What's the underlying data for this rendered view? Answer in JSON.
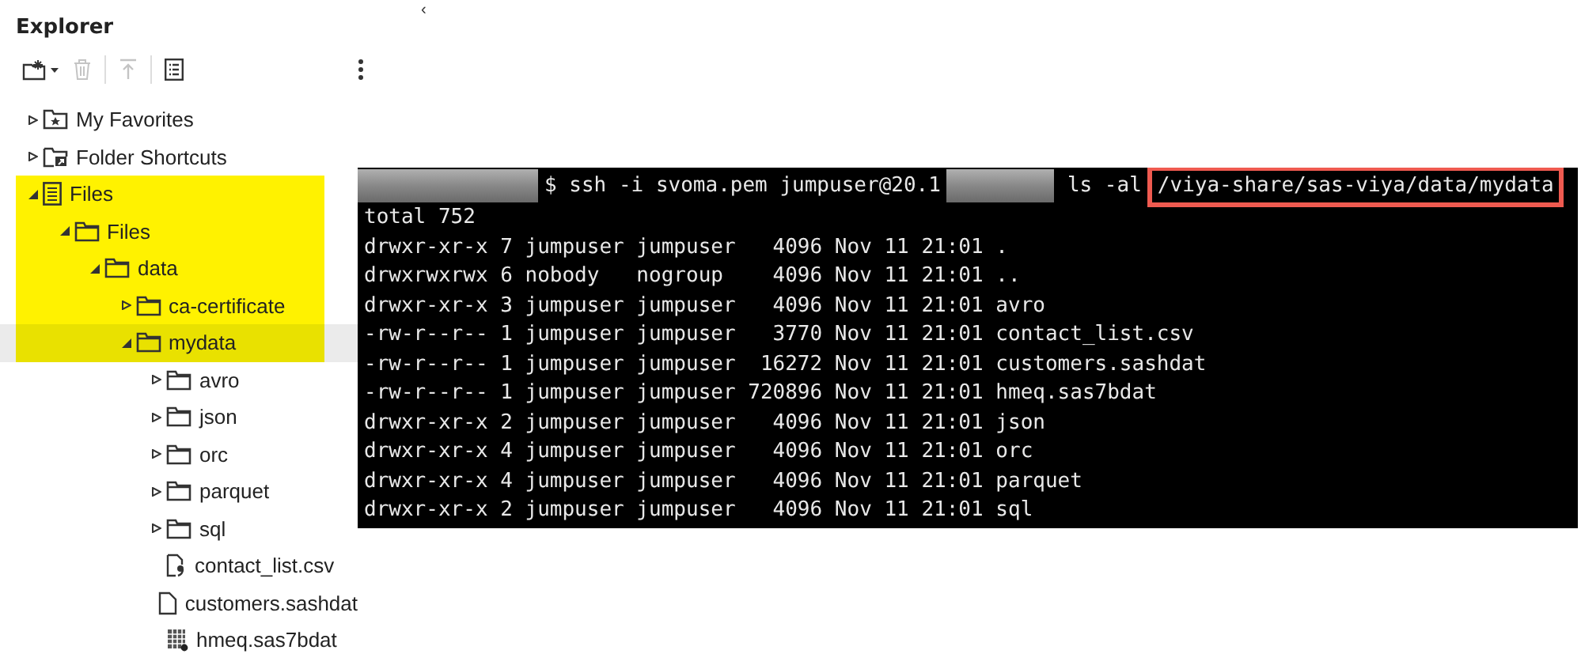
{
  "explorer": {
    "title": "Explorer",
    "collapse_glyph": "‹",
    "toolbar": [
      {
        "kind": "new",
        "disabled": false
      },
      {
        "kind": "delete",
        "disabled": true
      },
      {
        "kind": "upload",
        "disabled": true
      },
      {
        "kind": "properties",
        "disabled": false
      },
      {
        "kind": "more",
        "disabled": false
      }
    ],
    "tree": [
      {
        "label": "My Favorites",
        "kind": "favorites",
        "expanded": false,
        "highlighted": false,
        "selected": false
      },
      {
        "label": "Folder Shortcuts",
        "kind": "shortcuts",
        "expanded": false,
        "highlighted": false,
        "selected": false
      },
      {
        "label": "Files",
        "kind": "files-root",
        "expanded": true,
        "highlighted": true,
        "selected": false,
        "children": [
          {
            "label": "Files",
            "kind": "folder",
            "expanded": true,
            "highlighted": true,
            "selected": false,
            "children": [
              {
                "label": "data",
                "kind": "folder",
                "expanded": true,
                "highlighted": true,
                "selected": false,
                "children": [
                  {
                    "label": "ca-certificate",
                    "kind": "folder",
                    "expanded": false,
                    "highlighted": true,
                    "selected": false
                  },
                  {
                    "label": "mydata",
                    "kind": "folder",
                    "expanded": true,
                    "highlighted": true,
                    "selected": true,
                    "children": [
                      {
                        "label": "avro",
                        "kind": "folder",
                        "expanded": false,
                        "highlighted": false,
                        "selected": false
                      },
                      {
                        "label": "json",
                        "kind": "folder",
                        "expanded": false,
                        "highlighted": false,
                        "selected": false
                      },
                      {
                        "label": "orc",
                        "kind": "folder",
                        "expanded": false,
                        "highlighted": false,
                        "selected": false
                      },
                      {
                        "label": "parquet",
                        "kind": "folder",
                        "expanded": false,
                        "highlighted": false,
                        "selected": false
                      },
                      {
                        "label": "sql",
                        "kind": "folder",
                        "expanded": false,
                        "highlighted": false,
                        "selected": false
                      },
                      {
                        "label": "contact_list.csv",
                        "kind": "csv",
                        "highlighted": false,
                        "selected": false
                      },
                      {
                        "label": "customers.sashdat",
                        "kind": "document",
                        "highlighted": false,
                        "selected": false
                      },
                      {
                        "label": "hmeq.sas7bdat",
                        "kind": "table",
                        "highlighted": false,
                        "selected": false
                      }
                    ]
                  }
                ]
              }
            ]
          }
        ]
      }
    ]
  },
  "terminal": {
    "prompt": [
      {
        "kind": "redacted"
      },
      {
        "kind": "text",
        "text": "$ ssh -i svoma.pem jumpuser@20.1"
      },
      {
        "kind": "redacted"
      },
      {
        "kind": "text",
        "text": "ls -al"
      },
      {
        "kind": "boxed",
        "text": "/viya-share/sas-viya/data/mydata"
      }
    ],
    "lines": [
      "total 752",
      "drwxr-xr-x 7 jumpuser jumpuser   4096 Nov 11 21:01 .",
      "drwxrwxrwx 6 nobody   nogroup    4096 Nov 11 21:01 ..",
      "drwxr-xr-x 3 jumpuser jumpuser   4096 Nov 11 21:01 avro",
      "-rw-r--r-- 1 jumpuser jumpuser   3770 Nov 11 21:01 contact_list.csv",
      "-rw-r--r-- 1 jumpuser jumpuser  16272 Nov 11 21:01 customers.sashdat",
      "-rw-r--r-- 1 jumpuser jumpuser 720896 Nov 11 21:01 hmeq.sas7bdat",
      "drwxr-xr-x 2 jumpuser jumpuser   4096 Nov 11 21:01 json",
      "drwxr-xr-x 4 jumpuser jumpuser   4096 Nov 11 21:01 orc",
      "drwxr-xr-x 4 jumpuser jumpuser   4096 Nov 11 21:01 parquet",
      "drwxr-xr-x 2 jumpuser jumpuser   4096 Nov 11 21:01 sql"
    ]
  }
}
